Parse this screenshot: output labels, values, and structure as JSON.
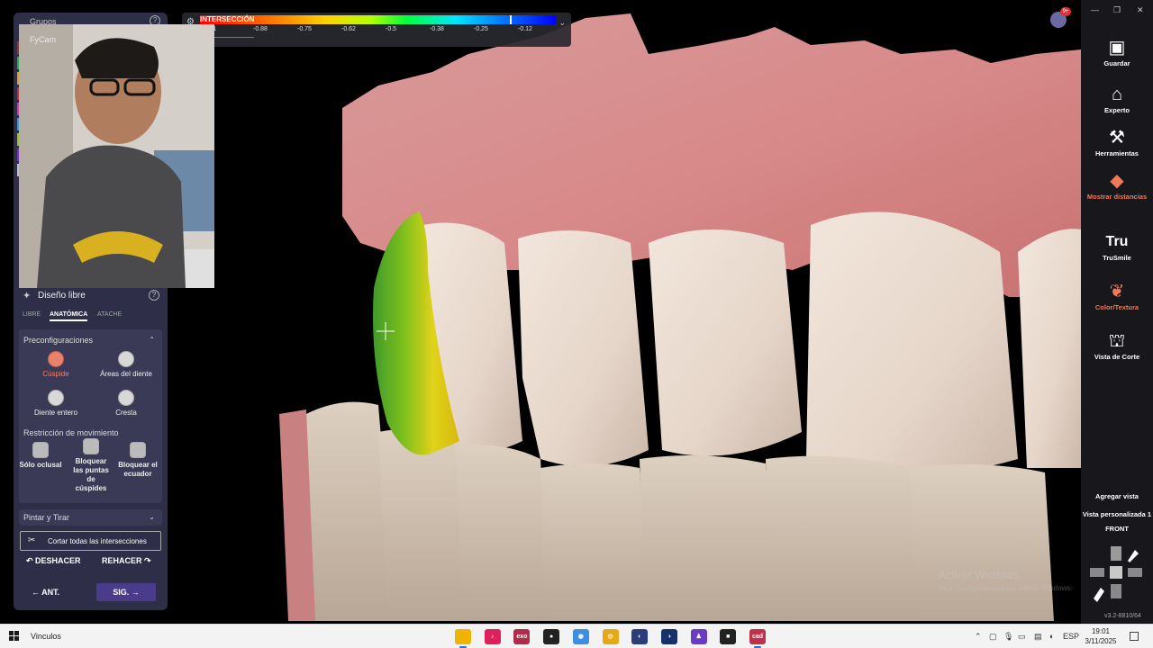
{
  "colorbar": {
    "title": "INTERSECCIÓN",
    "ticks": [
      "-1",
      "-0.88",
      "-0.75",
      "-0.62",
      "-0.5",
      "-0.38",
      "-0.25",
      "-0.12"
    ],
    "marker_fraction": 0.87
  },
  "left_panel": {
    "groups_title": "Grupos",
    "cam_label": "FyCam",
    "design_title": "Diseño libre",
    "tabs": [
      {
        "label": "LIBRE",
        "active": false
      },
      {
        "label": "ANATÓMICA",
        "active": true
      },
      {
        "label": "ATACHE",
        "active": false
      }
    ],
    "presets_title": "Preconfiguraciones",
    "presets": [
      {
        "label": "Cúspide",
        "active": true
      },
      {
        "label": "Áreas del diente",
        "active": false
      },
      {
        "label": "Diente entero",
        "active": false
      },
      {
        "label": "Cresta",
        "active": false
      }
    ],
    "restriction_title": "Restricción de movimiento",
    "restrictions": [
      {
        "label": "Sólo oclusal"
      },
      {
        "label": "Bloquear las puntas de cúspides"
      },
      {
        "label": "Bloquear el ecuador"
      }
    ],
    "paint_title": "Pintar y Tirar",
    "cut_all_label": "Cortar todas las intersecciones",
    "undo_label": "DESHACER",
    "redo_label": "REHACER",
    "prev_label": "ANT.",
    "next_label": "SIG."
  },
  "right_toolbar": {
    "tools": [
      {
        "label": "Guardar",
        "icon": "save-icon",
        "highlight": false
      },
      {
        "label": "Experto",
        "icon": "graduation-cap-icon",
        "highlight": false
      },
      {
        "label": "Herramientas",
        "icon": "tools-icon",
        "highlight": false
      },
      {
        "label": "Mostrar distancias",
        "icon": "show-distances-icon",
        "highlight": true
      },
      {
        "label": "TruSmile",
        "icon": "trusmile-icon",
        "highlight": false
      },
      {
        "label": "Color/Textura",
        "icon": "color-texture-icon",
        "highlight": true
      },
      {
        "label": "Vista de Corte",
        "icon": "cut-view-icon",
        "highlight": false
      }
    ],
    "add_view": "Agregar vista",
    "custom_view": "Vista personalizada 1",
    "front": "FRONT",
    "version": "v3.2-8810/64",
    "notification_badge": "9+"
  },
  "watermark": {
    "line1": "Activar Windows",
    "line2": "Ve a Configuración para activar Windows."
  },
  "taskbar": {
    "search_text": "Vinculos",
    "language": "ESP",
    "time": "19:01",
    "date": "3/11/2025",
    "apps": [
      {
        "name": "file-explorer-icon",
        "color": "#f0b400",
        "label": ""
      },
      {
        "name": "tiktok-icon",
        "color": "#e0205a",
        "label": "♪"
      },
      {
        "name": "exocad-icon",
        "color": "#b22a4a",
        "label": "exo"
      },
      {
        "name": "obs-icon",
        "color": "#222222",
        "label": "●"
      },
      {
        "name": "meshmixer-icon",
        "color": "#3c8fe0",
        "label": "◉"
      },
      {
        "name": "chrome-icon",
        "color": "#e6a817",
        "label": "◎"
      },
      {
        "name": "app-blue-icon",
        "color": "#2a3d7a",
        "label": "◐"
      },
      {
        "name": "app-dark-icon",
        "color": "#15326a",
        "label": "◑"
      },
      {
        "name": "app-purple-icon",
        "color": "#6a3cc0",
        "label": "♟"
      },
      {
        "name": "record-icon",
        "color": "#222222",
        "label": "■"
      },
      {
        "name": "exocad-cad-icon",
        "color": "#c0304a",
        "label": "cad"
      }
    ]
  }
}
